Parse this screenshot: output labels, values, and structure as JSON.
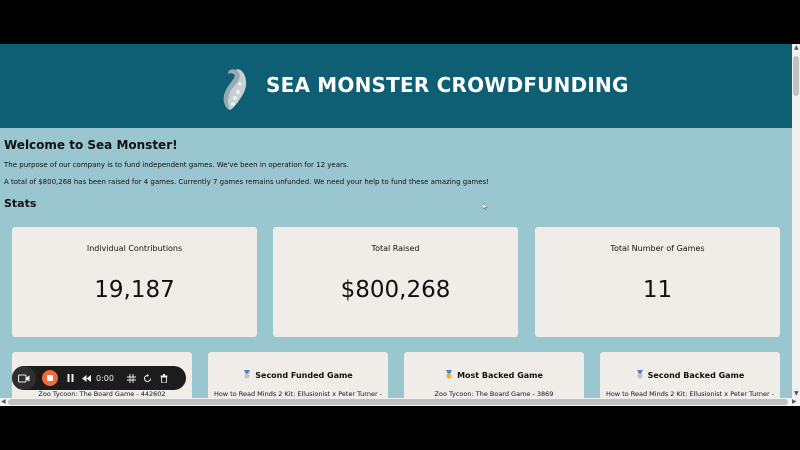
{
  "header": {
    "title": "SEA MONSTER CROWDFUNDING",
    "logo_icon": "tentacle-icon"
  },
  "intro": {
    "welcome": "Welcome to Sea Monster!",
    "purpose": "The purpose of our company is to fund independent games. We've been in operation for 12 years.",
    "raised": "A total of $800,268 has been raised for 4 games. Currently 7 games remains unfunded. We need your help to fund these amazing games!"
  },
  "stats": {
    "heading": "Stats",
    "cards": [
      {
        "label": "Individual Contributions",
        "value": "19,187"
      },
      {
        "label": "Total Raised",
        "value": "$800,268"
      },
      {
        "label": "Total Number of Games",
        "value": "11"
      }
    ]
  },
  "games": [
    {
      "title": "",
      "name": "Zoo Tycoon: The Board Game - 442602"
    },
    {
      "title": "Second Funded Game",
      "icon": "silver-medal-icon",
      "name": "How to Read Minds 2 Kit: Ellusionist x Peter Turner - "
    },
    {
      "title": "Most Backed Game",
      "icon": "gold-medal-icon",
      "name": "Zoo Tycoon: The Board Game - 3869"
    },
    {
      "title": "Second Backed Game",
      "icon": "silver-medal-icon",
      "name": "How to Read Minds 2 Kit: Ellusionist x Peter Turner - "
    }
  ],
  "recorder": {
    "timer": "0:00",
    "icons": [
      "camera-icon",
      "stop-icon",
      "pause-icon",
      "rewind-icon",
      "grid-icon",
      "restart-icon",
      "trash-icon"
    ]
  },
  "colors": {
    "header_bg": "#0f5f74",
    "page_bg": "#99c6cf",
    "card_bg": "#f0ede8",
    "record_accent": "#f26b3a"
  }
}
